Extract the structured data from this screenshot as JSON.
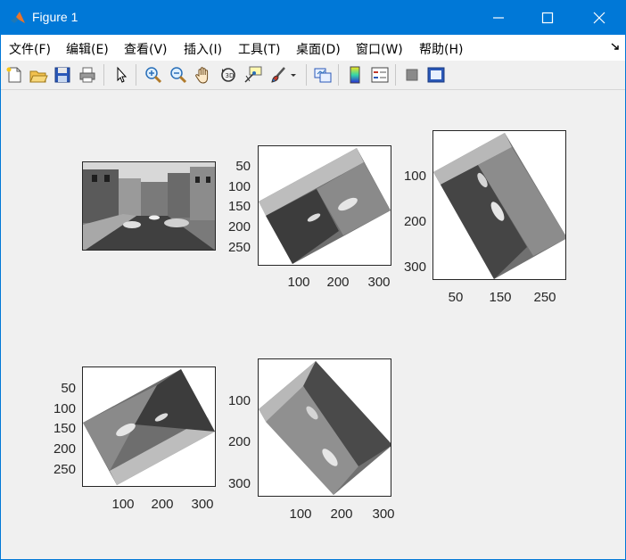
{
  "window": {
    "title": "Figure 1"
  },
  "menu": [
    "文件(F)",
    "编辑(E)",
    "查看(V)",
    "插入(I)",
    "工具(T)",
    "桌面(D)",
    "窗口(W)",
    "帮助(H)"
  ],
  "toolbar": [
    "new-figure",
    "open-file",
    "save",
    "print",
    "select-pointer",
    "zoom-in",
    "zoom-out",
    "pan",
    "rotate-3d",
    "data-cursor",
    "brush",
    "brush-dropdown",
    "link-plot",
    "insert-colorbar",
    "insert-legend",
    "hide-plot-tools",
    "show-plot-tools"
  ],
  "axes": [
    {
      "id": "original",
      "yticks": [],
      "xticks": []
    },
    {
      "id": "rot30",
      "yticks": [
        "50",
        "100",
        "150",
        "200",
        "250"
      ],
      "xticks": [
        "100",
        "200",
        "300"
      ]
    },
    {
      "id": "rot60",
      "yticks": [
        "100",
        "200",
        "300"
      ],
      "xticks": [
        "50",
        "150",
        "250"
      ]
    },
    {
      "id": "rot150",
      "yticks": [
        "50",
        "100",
        "150",
        "200",
        "250"
      ],
      "xticks": [
        "100",
        "200",
        "300"
      ]
    },
    {
      "id": "rot120",
      "yticks": [
        "100",
        "200",
        "300"
      ],
      "xticks": [
        "100",
        "200",
        "300"
      ]
    }
  ]
}
